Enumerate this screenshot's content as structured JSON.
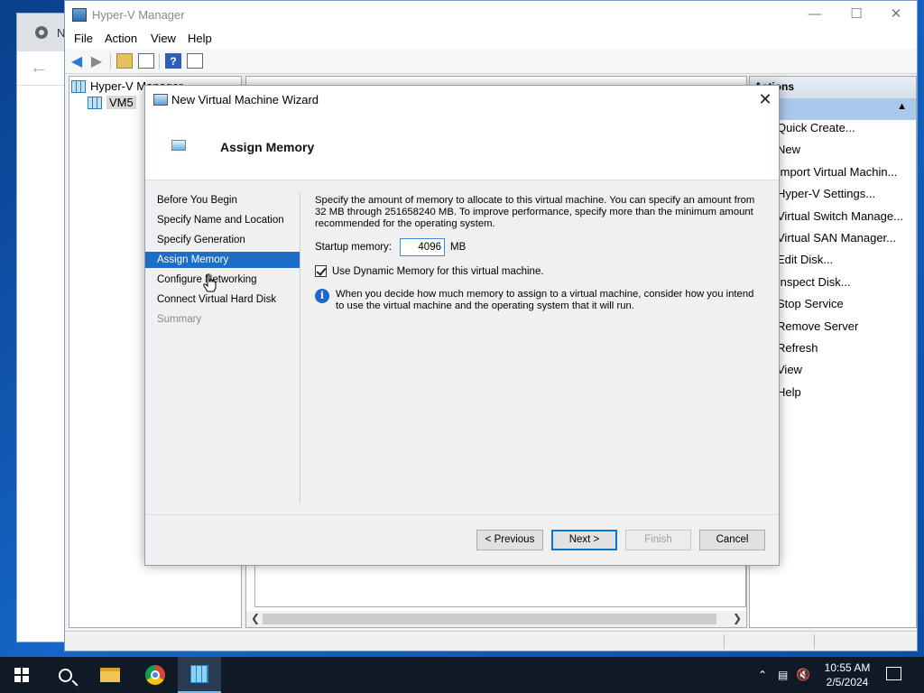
{
  "browser": {
    "tab_text": "N"
  },
  "mmc": {
    "title": "Hyper-V Manager",
    "menu": [
      "File",
      "Action",
      "View",
      "Help"
    ],
    "tree": {
      "root": "Hyper-V Manager",
      "server": "VM5"
    },
    "actions": {
      "header": "Actions",
      "items": [
        {
          "label": "Quick Create...",
          "submenu": false
        },
        {
          "label": "New",
          "submenu": true
        },
        {
          "label": "Import Virtual Machin...",
          "submenu": false
        },
        {
          "label": "Hyper-V Settings...",
          "submenu": false
        },
        {
          "label": "Virtual Switch Manage...",
          "submenu": false
        },
        {
          "label": "Virtual SAN Manager...",
          "submenu": false
        },
        {
          "label": "Edit Disk...",
          "submenu": false
        },
        {
          "label": "Inspect Disk...",
          "submenu": false
        },
        {
          "label": "Stop Service",
          "submenu": false
        },
        {
          "label": "Remove Server",
          "submenu": false
        },
        {
          "label": "Refresh",
          "submenu": false
        },
        {
          "label": "View",
          "submenu": true
        },
        {
          "label": "Help",
          "submenu": false
        }
      ]
    }
  },
  "wizard": {
    "title": "New Virtual Machine Wizard",
    "page_title": "Assign Memory",
    "steps": [
      {
        "label": "Before You Begin",
        "state": "normal"
      },
      {
        "label": "Specify Name and Location",
        "state": "normal"
      },
      {
        "label": "Specify Generation",
        "state": "normal"
      },
      {
        "label": "Assign Memory",
        "state": "active"
      },
      {
        "label": "Configure Networking",
        "state": "normal"
      },
      {
        "label": "Connect Virtual Hard Disk",
        "state": "normal"
      },
      {
        "label": "Summary",
        "state": "disabled"
      }
    ],
    "description": "Specify the amount of memory to allocate to this virtual machine. You can specify an amount from 32 MB through 251658240 MB. To improve performance, specify more than the minimum amount recommended for the operating system.",
    "startup_memory_label": "Startup memory:",
    "startup_memory_value": "4096",
    "startup_memory_unit": "MB",
    "dynamic_memory_label": "Use Dynamic Memory for this virtual machine.",
    "dynamic_memory_checked": true,
    "info_text": "When you decide how much memory to assign to a virtual machine, consider how you intend to use the virtual machine and the operating system that it will run.",
    "buttons": {
      "previous": "< Previous",
      "next": "Next >",
      "finish": "Finish",
      "cancel": "Cancel"
    }
  },
  "taskbar": {
    "time": "10:55 AM",
    "date": "2/5/2024"
  },
  "colors": {
    "selection": "#1e6ec8",
    "taskbar": "#101a27",
    "accent": "#0078d7"
  }
}
